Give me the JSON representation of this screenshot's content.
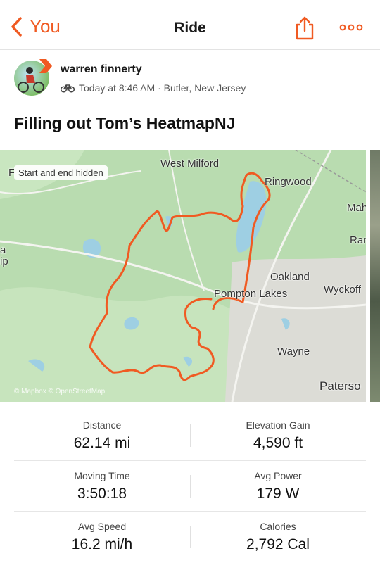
{
  "nav": {
    "back_label": "You",
    "title": "Ride"
  },
  "athlete": {
    "name": "warren finnerty",
    "meta": "Today at 8:46 AM · Butler, New Jersey"
  },
  "activity": {
    "title": "Filling out Tom’s HeatmapNJ"
  },
  "map": {
    "privacy_label": "Start and end hidden",
    "attribution": "© Mapbox © OpenStreetMap",
    "places": [
      "West Milford",
      "Ringwood",
      "Mah",
      "Ran",
      "Oakland",
      "Wyckoff",
      "Pompton Lakes",
      "Wayne",
      "Paterso",
      "ip",
      "a",
      "F"
    ],
    "route_color": "#f05a22"
  },
  "stats": [
    {
      "left": {
        "label": "Distance",
        "value": "62.14 mi"
      },
      "right": {
        "label": "Elevation Gain",
        "value": "4,590 ft"
      }
    },
    {
      "left": {
        "label": "Moving Time",
        "value": "3:50:18"
      },
      "right": {
        "label": "Avg Power",
        "value": "179 W"
      }
    },
    {
      "left": {
        "label": "Avg Speed",
        "value": "16.2 mi/h"
      },
      "right": {
        "label": "Calories",
        "value": "2,792 Cal"
      }
    }
  ],
  "icons": {
    "back": "chevron-left-icon",
    "share": "share-icon",
    "more": "more-icon",
    "sport": "bike-icon"
  },
  "colors": {
    "accent": "#f05a22"
  }
}
